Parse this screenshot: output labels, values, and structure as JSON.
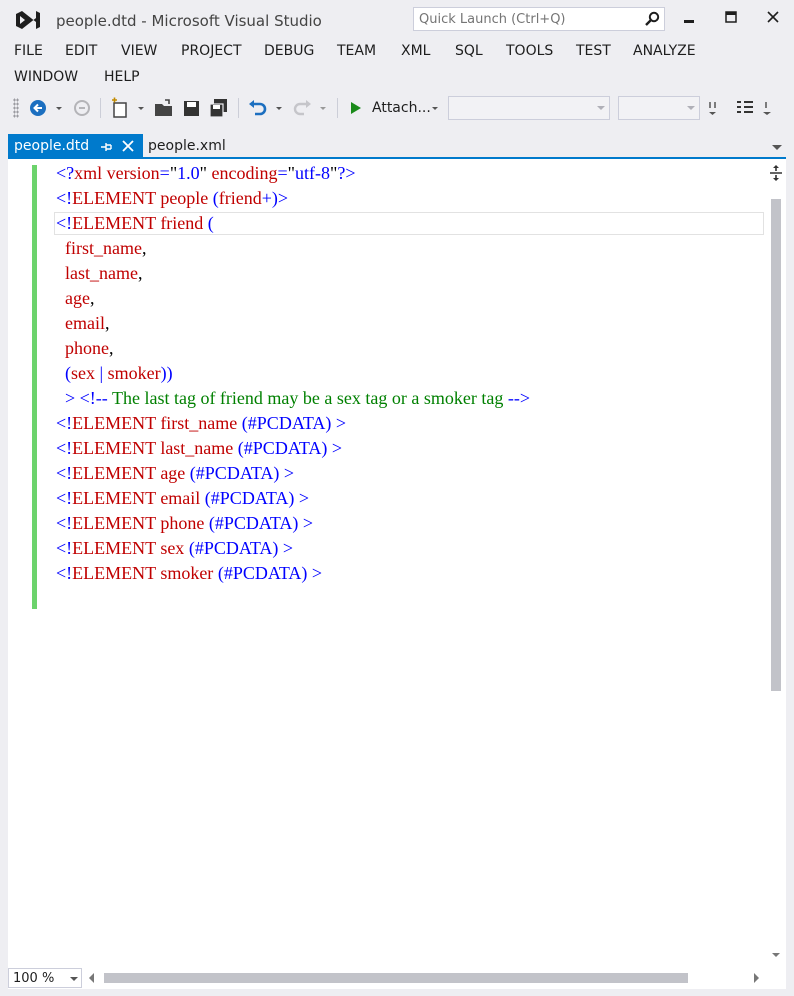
{
  "window": {
    "title": "people.dtd - Microsoft Visual Studio",
    "quick_launch_placeholder": "Quick Launch (Ctrl+Q)",
    "minimize_icon": "minimize-icon",
    "maximize_icon": "maximize-icon",
    "close_icon": "close-icon"
  },
  "menu": {
    "items": [
      {
        "label": "FILE"
      },
      {
        "label": "EDIT"
      },
      {
        "label": "VIEW"
      },
      {
        "label": "PROJECT"
      },
      {
        "label": "DEBUG"
      },
      {
        "label": "TEAM"
      },
      {
        "label": "XML"
      },
      {
        "label": "SQL"
      },
      {
        "label": "TOOLS"
      },
      {
        "label": "TEST"
      },
      {
        "label": "ANALYZE"
      },
      {
        "label": "WINDOW"
      },
      {
        "label": "HELP"
      }
    ]
  },
  "toolbar": {
    "attach_label": "Attach...",
    "icons": [
      "back-icon",
      "forward-icon",
      "new-project-icon",
      "open-icon",
      "save-icon",
      "save-all-icon",
      "undo-icon",
      "redo-icon",
      "start-icon"
    ]
  },
  "tabs": [
    {
      "label": "people.dtd",
      "active": true
    },
    {
      "label": "people.xml",
      "active": false
    }
  ],
  "editor": {
    "lines": [
      "<?xml version=\"1.0\" encoding=\"utf-8\"?>",
      "<!ELEMENT people (friend+)>",
      "<!ELEMENT friend (",
      "  first_name,",
      "  last_name,",
      "  age,",
      "  email,",
      "  phone,",
      "  (sex | smoker))",
      "  > <!-- The last tag of friend may be a sex tag or a smoker tag -->",
      "<!ELEMENT first_name (#PCDATA) >",
      "<!ELEMENT last_name (#PCDATA) >",
      "<!ELEMENT age (#PCDATA) >",
      "<!ELEMENT email (#PCDATA) >",
      "<!ELEMENT phone (#PCDATA) >",
      "<!ELEMENT sex (#PCDATA) >",
      "<!ELEMENT smoker (#PCDATA) >"
    ],
    "colors": {
      "keyword": "#c00000",
      "delimiter": "#0000ff",
      "comment": "#008000",
      "text": "#000000"
    }
  },
  "status": {
    "zoom": "100 %"
  },
  "colors": {
    "accent": "#007acc",
    "change_margin": "#6cd36c",
    "background": "#eeeef2"
  }
}
